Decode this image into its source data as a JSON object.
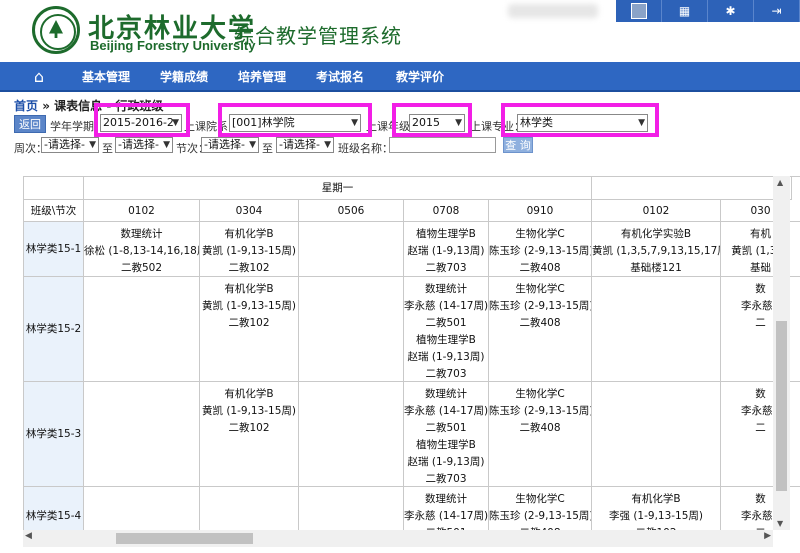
{
  "header": {
    "logo_cn": "北京林业大学",
    "logo_en": "Beijing Forestry University",
    "system_title": "综合教学管理系统"
  },
  "nav": {
    "items": [
      "基本管理",
      "学籍成绩",
      "培养管理",
      "考试报名",
      "教学评价"
    ]
  },
  "breadcrumb": {
    "home": "首页",
    "separator": "»",
    "current": "课表信息 - 行政班级"
  },
  "filters": {
    "back_label": "返回",
    "term_label": "学年学期：",
    "term_value": "2015-2016-2",
    "college_label": "上课院系：",
    "college_value": "[001]林学院",
    "grade_label": "上课年级：",
    "grade_value": "2015",
    "major_label": "上课专业：",
    "major_value": "林学类",
    "week_label": "周次：",
    "week_from": "-请选择-",
    "to_label": "至",
    "week_to": "-请选择-",
    "period_label": "节次：",
    "period_from": "-请选择-",
    "period_to": "-请选择-",
    "class_label": "班级名称：",
    "class_value": "",
    "query_label": "查 询",
    "highlight_color": "#f21ee6"
  },
  "timetable": {
    "corner": "班级\\节次",
    "day": "星期一",
    "periods": [
      "0102",
      "0304",
      "0506",
      "0708",
      "0910",
      "0102",
      "030"
    ],
    "rows": [
      {
        "class": "林学类15-1",
        "cells": [
          [
            "数理统计",
            "徐松 (1-8,13-14,16,18周)",
            "二教502"
          ],
          [
            "有机化学B",
            "黄凯 (1-9,13-15周)",
            "二教102"
          ],
          [],
          [
            "植物生理学B",
            "赵瑞 (1-9,13周)",
            "二教703"
          ],
          [
            "生物化学C",
            "陈玉珍 (2-9,13-15周)",
            "二教408"
          ],
          [
            "有机化学实验B",
            "黄凯 (1,3,5,7,9,13,15,17周)",
            "基础楼121"
          ],
          [
            "有机",
            "黄凯 (1,3,5,",
            "基础"
          ]
        ]
      },
      {
        "class": "林学类15-2",
        "cells": [
          [],
          [
            "有机化学B",
            "黄凯 (1-9,13-15周)",
            "二教102"
          ],
          [],
          [
            "数理统计",
            "李永慈 (14-17周)",
            "二教501",
            "植物生理学B",
            "赵瑞 (1-9,13周)",
            "二教703"
          ],
          [
            "生物化学C",
            "陈玉珍 (2-9,13-15周)",
            "二教408"
          ],
          [],
          [
            "数",
            "李永慈 (",
            "二"
          ]
        ]
      },
      {
        "class": "林学类15-3",
        "cells": [
          [],
          [
            "有机化学B",
            "黄凯 (1-9,13-15周)",
            "二教102"
          ],
          [],
          [
            "数理统计",
            "李永慈 (14-17周)",
            "二教501",
            "植物生理学B",
            "赵瑞 (1-9,13周)",
            "二教703"
          ],
          [
            "生物化学C",
            "陈玉珍 (2-9,13-15周)",
            "二教408"
          ],
          [],
          [
            "数",
            "李永慈 (",
            "二"
          ]
        ]
      },
      {
        "class": "林学类15-4",
        "cells": [
          [],
          [],
          [],
          [
            "数理统计",
            "李永慈 (14-17周)",
            "二教501"
          ],
          [
            "生物化学C",
            "陈玉珍 (2-9,13-15周)",
            "二教408"
          ],
          [
            "有机化学B",
            "李强 (1-9,13-15周)",
            "二教102"
          ],
          [
            "数",
            "李永慈 (",
            "二"
          ]
        ]
      }
    ]
  }
}
